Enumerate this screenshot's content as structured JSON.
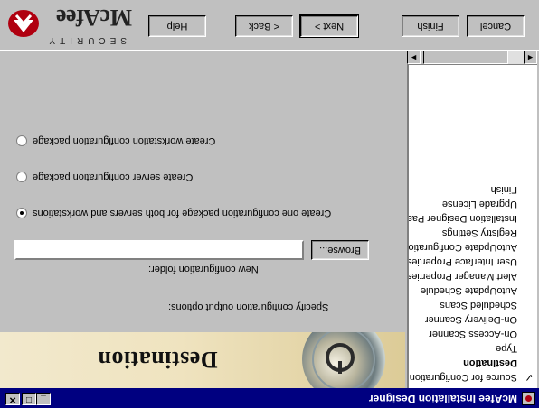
{
  "window": {
    "title": "McAfee Installation Designer",
    "min_label": "_",
    "max_label": "□",
    "close_label": "✕"
  },
  "nav": {
    "items": [
      {
        "label": "Source for Configuration",
        "checked": true
      },
      {
        "label": "Destination",
        "active": true
      },
      {
        "label": "Type"
      },
      {
        "label": "On-Access Scanner"
      },
      {
        "label": "On-Delivery Scanner"
      },
      {
        "label": "Scheduled Scans"
      },
      {
        "label": "AutoUpdate Schedule"
      },
      {
        "label": "Alert Manager Properties"
      },
      {
        "label": "User Interface Properties"
      },
      {
        "label": "AutoUpdate Configuration"
      },
      {
        "label": "Registry Settings"
      },
      {
        "label": "Installation Designer Password"
      },
      {
        "label": "Upgrade License"
      },
      {
        "label": "Finish"
      }
    ],
    "scroll_left": "◄",
    "scroll_right": "►"
  },
  "banner": {
    "title": "Destination"
  },
  "main": {
    "specify_label": "Specify configuration output options:",
    "folder_label": "New configuration folder:",
    "folder_value": "",
    "browse_label": "Browse...",
    "options": [
      {
        "label": "Create one configuration package for both servers and workstations",
        "selected": true
      },
      {
        "label": "Create server configuration package",
        "selected": false
      },
      {
        "label": "Create workstation configuration package",
        "selected": false
      }
    ]
  },
  "footer": {
    "help": "Help",
    "back": "< Back",
    "next": "Next >",
    "finish": "Finish",
    "cancel": "Cancel"
  },
  "logo": {
    "word": "McAfee",
    "sub": "SECURITY"
  },
  "colors": {
    "titlebar": "#000080",
    "face": "#c0c0c0",
    "banner": "#e8dbb3",
    "brand_red": "#b00010"
  }
}
